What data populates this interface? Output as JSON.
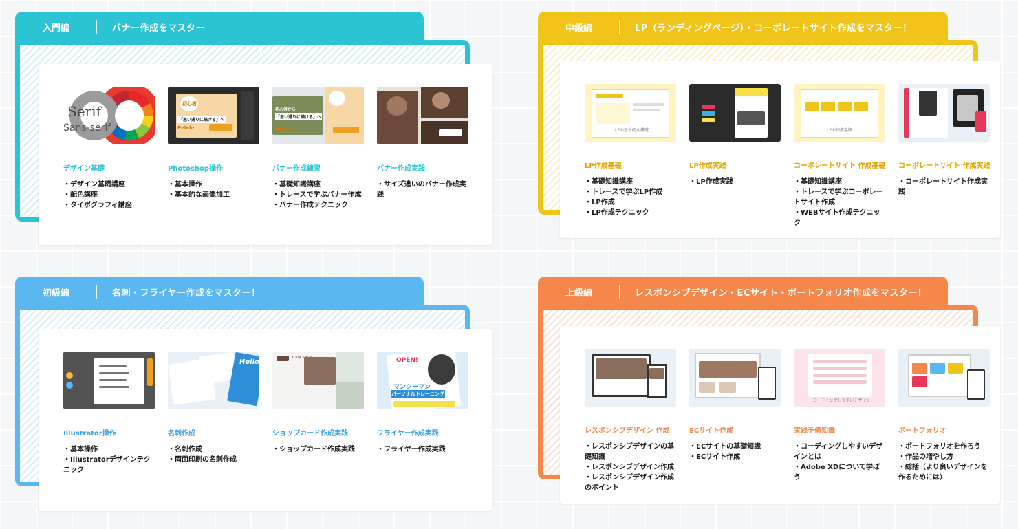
{
  "sections": [
    {
      "id": "intro",
      "level": "入門編",
      "title": "バナー作成をマスター",
      "color": "#2bc4d4",
      "courses": [
        {
          "title": "デザイン基礎",
          "items": [
            "デザイン基礎講座",
            "配色講座",
            "タイポグラフィ講座"
          ],
          "thumb_icon": "color-wheel-icon",
          "thumb_text": [
            "Serif",
            "Sans-serif"
          ]
        },
        {
          "title": "Photoshop操作",
          "items": [
            "基本操作",
            "基本的な画像加工"
          ],
          "thumb_icon": "photoshop-screen-icon",
          "thumb_text": [
            "初心者",
            "「思い通りに描ける」へ",
            "Pelele"
          ]
        },
        {
          "title": "バナー作成練習",
          "items": [
            "基礎知識講座",
            "トレースで学ぶバナー作成",
            "バナー作成テクニック"
          ],
          "thumb_icon": "banner-samples-icon",
          "thumb_text": [
            "初心者から",
            "「思い通りに描ける」へ",
            "Pelele"
          ]
        },
        {
          "title": "バナー作成実践",
          "items": [
            "サイズ違いのバナー作成実践"
          ],
          "thumb_icon": "cafe-banner-icon",
          "thumb_text": []
        }
      ]
    },
    {
      "id": "middle",
      "level": "中級編",
      "title": "LP（ランディングページ）・コーポレートサイト作成をマスター！",
      "color": "#f0c419",
      "courses": [
        {
          "title": "LP作成基礎",
          "items": [
            "基礎知識講座",
            "トレースで学ぶLP作成",
            "LP作成",
            "LP作成テクニック"
          ],
          "thumb_icon": "lp-wireframe-icon",
          "thumb_text": [
            "LPの基本的な構成"
          ]
        },
        {
          "title": "LP作成実践",
          "items": [
            "LP作成実践"
          ],
          "thumb_icon": "lp-design-icon",
          "thumb_text": []
        },
        {
          "title": "コーポレートサイト 作成基礎",
          "items": [
            "基礎知識講座",
            "トレースで学ぶコーポレートサイト作成",
            "WEBサイト作成テクニック"
          ],
          "thumb_icon": "site-wireframe-icon",
          "thumb_text": [
            "LPの作成手順"
          ]
        },
        {
          "title": "コーポレートサイト 作成実践",
          "items": [
            "コーポレートサイト作成実践"
          ],
          "thumb_icon": "corporate-site-icon",
          "thumb_text": []
        }
      ]
    },
    {
      "id": "beginner",
      "level": "初級編",
      "title": "名刺・フライヤー作成をマスター！",
      "color": "#5bb7ef",
      "courses": [
        {
          "title": "Illustrator操作",
          "items": [
            "基本操作",
            "Illustratorデザインテクニック"
          ],
          "thumb_icon": "illustrator-screen-icon",
          "thumb_text": []
        },
        {
          "title": "名刺作成",
          "items": [
            "名刺作成",
            "両面印刷の名刺作成"
          ],
          "thumb_icon": "business-card-icon",
          "thumb_text": [
            "Hello"
          ]
        },
        {
          "title": "ショップカード作成実践",
          "items": [
            "ショップカード作成実践"
          ],
          "thumb_icon": "shop-card-icon",
          "thumb_text": [
            "YOUR SHOP"
          ]
        },
        {
          "title": "フライヤー作成実践",
          "items": [
            "フライヤー作成実践"
          ],
          "thumb_icon": "flyer-icon",
          "thumb_text": [
            "OPEN!",
            "マンツーマン",
            "パーソナルトレーニング"
          ]
        }
      ]
    },
    {
      "id": "advanced",
      "level": "上級編",
      "title": "レスポンシブデザイン・ECサイト・ポートフォリオ作成をマスター！",
      "color": "#f5874b",
      "courses": [
        {
          "title": "レスポンシブデザイン 作成",
          "items": [
            "レスポンシブデザインの基礎知識",
            "レスポンシブデザイン作成",
            "レスポンシブデザイン作成のポイント"
          ],
          "thumb_icon": "responsive-devices-icon",
          "thumb_text": []
        },
        {
          "title": "ECサイト作成",
          "items": [
            "ECサイトの基礎知識",
            "ECサイト作成"
          ],
          "thumb_icon": "ec-site-icon",
          "thumb_text": []
        },
        {
          "title": "実践予備知識",
          "items": [
            "コーディングしやすいデザインとは",
            "Adobe XDについて学ぼう"
          ],
          "thumb_icon": "coding-checklist-icon",
          "thumb_text": [
            "コーディングしやすいデザイン"
          ]
        },
        {
          "title": "ポートフォリオ",
          "items": [
            "ポートフォリオを作ろう",
            "作品の増やし方",
            "総括（より良いデザインを作るためには）"
          ],
          "thumb_icon": "portfolio-devices-icon",
          "thumb_text": []
        }
      ]
    }
  ]
}
